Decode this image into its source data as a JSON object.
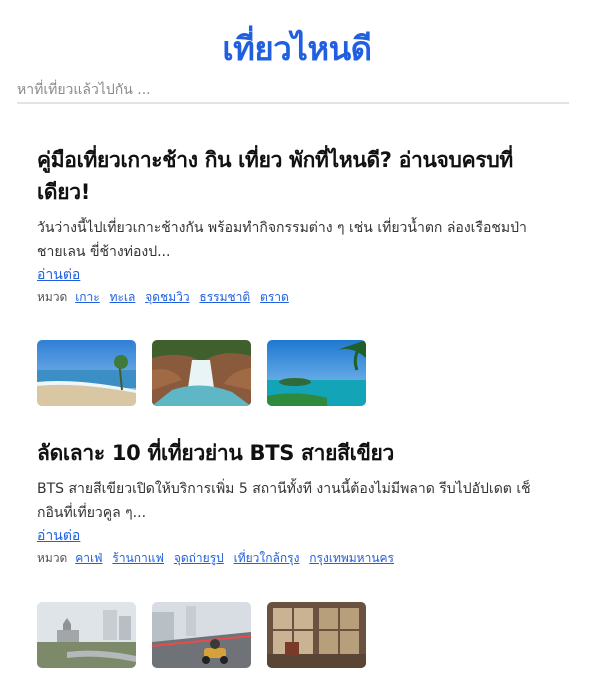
{
  "header": {
    "title": "เที่ยวไหนดี"
  },
  "search": {
    "placeholder": "หาที่เที่ยวแล้วไปกัน ..."
  },
  "posts": [
    {
      "title": "คู่มือเที่ยวเกาะช้าง กิน เที่ยว พักที่ไหนดี? อ่านจบครบที่เดียว!",
      "excerpt": "วันว่างนี้ไปเที่ยวเกาะช้างกัน พร้อมทำกิจกรรมต่าง ๆ เช่น เที่ยวน้ำตก ล่องเรือชมป่าชายเลน ขี่ช้างท่องป...",
      "read_more": "อ่านต่อ",
      "category_label": "หมวด",
      "categories": [
        "เกาะ",
        "ทะเล",
        "จุดชมวิว",
        "ธรรมชาติ",
        "ตราด"
      ],
      "thumbnails": [
        "beach-photo",
        "waterfall-photo",
        "island-photo"
      ]
    },
    {
      "title": "ลัดเลาะ 10 ที่เที่ยวย่าน BTS สายสีเขียว",
      "excerpt": "BTS สายสีเขียวเปิดให้บริการเพิ่ม 5 สถานีทั้งที งานนี้ต้องไม่มีพลาด รีบไปอัปเดต เช็กอินที่เที่ยวคูล ๆ...",
      "read_more": "อ่านต่อ",
      "category_label": "หมวด",
      "categories": [
        "คาเฟ่",
        "ร้านกาแฟ",
        "จุดถ่ายรูป",
        "เที่ยวใกล้กรุง",
        "กรุงเทพมหานคร"
      ],
      "thumbnails": [
        "city-park-photo",
        "go-kart-photo",
        "cafe-interior-photo"
      ]
    }
  ],
  "colors": {
    "accent": "#1f5fe0",
    "title": "#111111",
    "text": "#333333"
  }
}
